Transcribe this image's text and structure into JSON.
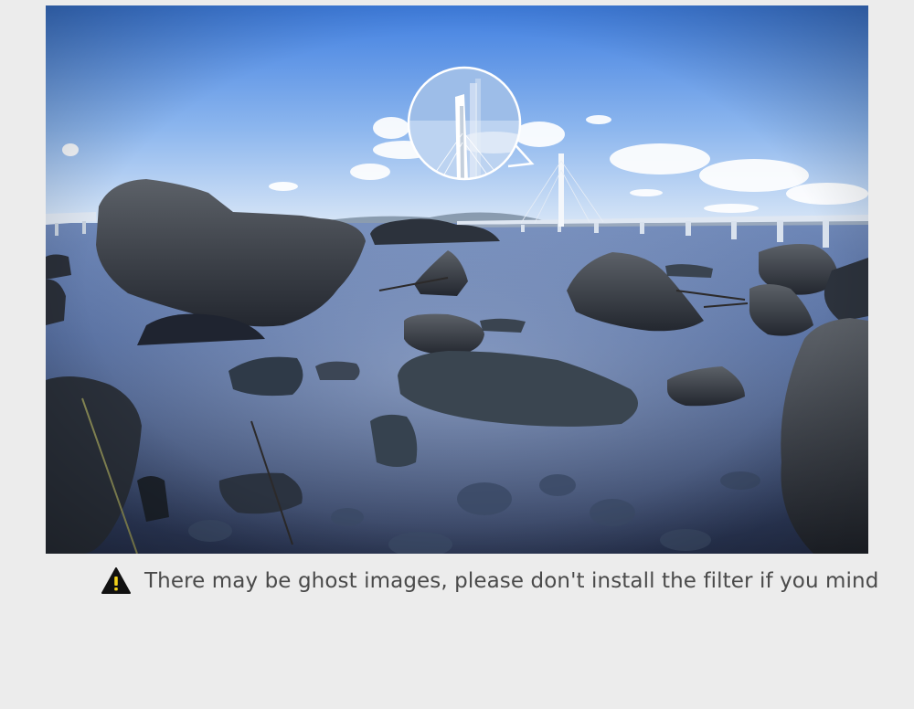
{
  "caption": {
    "icon": "warning-triangle-icon",
    "text": "There may be ghost images, please don't install the filter if you mind"
  },
  "colors": {
    "page_background": "#ececec",
    "caption_text": "#4a4a4a",
    "warning_icon_fill": "#111111",
    "warning_icon_mark": "#f2d21b"
  }
}
